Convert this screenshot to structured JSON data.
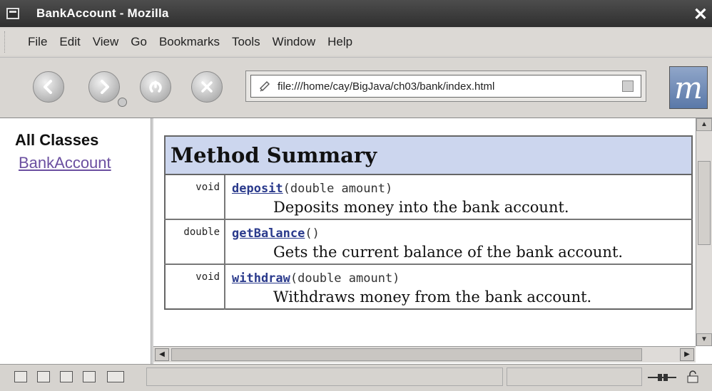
{
  "window": {
    "title": "BankAccount - Mozilla",
    "close_glyph": "✕"
  },
  "menu": {
    "items": [
      "File",
      "Edit",
      "View",
      "Go",
      "Bookmarks",
      "Tools",
      "Window",
      "Help"
    ]
  },
  "nav": {
    "url": "file:///home/cay/BigJava/ch03/bank/index.html",
    "logo": "m",
    "icons": [
      "back-icon",
      "forward-icon",
      "reload-icon",
      "stop-icon"
    ]
  },
  "sidebar": {
    "heading": "All Classes",
    "link": "BankAccount"
  },
  "summary": {
    "title": "Method Summary",
    "methods": [
      {
        "return_type": "void",
        "name": "deposit",
        "params": "(double amount)",
        "description": "Deposits money into the bank account."
      },
      {
        "return_type": "double",
        "name": "getBalance",
        "params": "()",
        "description": "Gets the current balance of the bank account."
      },
      {
        "return_type": "void",
        "name": "withdraw",
        "params": "(double amount)",
        "description": "Withdraws money from the bank account."
      }
    ]
  },
  "colors": {
    "table_header_bg": "#ccd6ee",
    "method_link": "#2a3a8c",
    "class_link": "#6b4fa0"
  }
}
